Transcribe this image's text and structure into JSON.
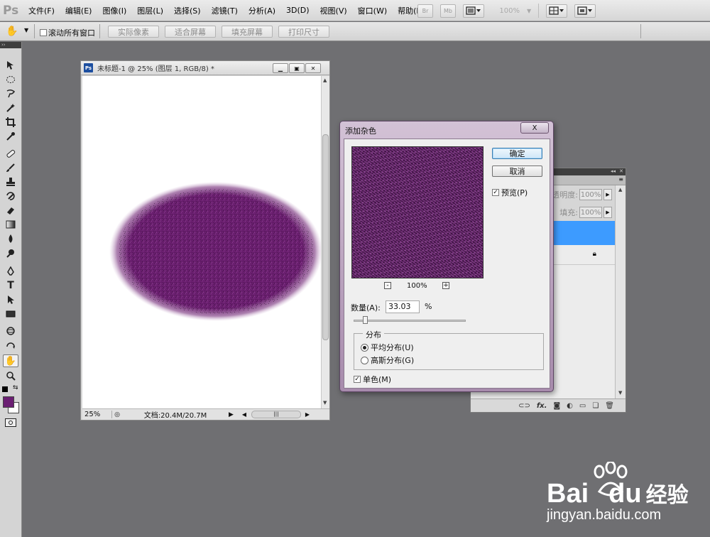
{
  "app": {
    "logo": "Ps"
  },
  "menubar": {
    "items": [
      "文件(F)",
      "编辑(E)",
      "图像(I)",
      "图层(L)",
      "选择(S)",
      "滤镜(T)",
      "分析(A)",
      "3D(D)",
      "视图(V)",
      "窗口(W)",
      "帮助(H)"
    ],
    "right": {
      "br_label": "Br",
      "mb_label": "Mb",
      "zoom": "100%"
    }
  },
  "options": {
    "scroll_all_label": "滚动所有窗口",
    "buttons": [
      "实际像素",
      "适合屏幕",
      "填充屏幕",
      "打印尺寸"
    ]
  },
  "toolbox": {
    "icons": [
      "move-tool-icon",
      "marquee-tool-icon",
      "lasso-tool-icon",
      "magic-wand-tool-icon",
      "crop-tool-icon",
      "eyedropper-tool-icon",
      "healing-brush-tool-icon",
      "brush-tool-icon",
      "clone-stamp-tool-icon",
      "history-brush-tool-icon",
      "eraser-tool-icon",
      "gradient-tool-icon",
      "blur-tool-icon",
      "dodge-tool-icon",
      "pen-tool-icon",
      "type-tool-icon",
      "path-selection-tool-icon",
      "rectangle-tool-icon",
      "3d-rotate-tool-icon",
      "3d-orbit-tool-icon",
      "hand-tool-icon",
      "zoom-tool-icon"
    ],
    "foreground_color": "#6b1f73",
    "background_color": "#ffffff"
  },
  "document": {
    "title": "未标题-1 @ 25% (图层 1, RGB/8) *",
    "zoom": "25%",
    "doc_info": "文档:20.4M/20.7M",
    "ellipse_color": "#6a1f6f"
  },
  "layers_panel": {
    "opacity_label": "不透明度:",
    "opacity_value": "100%",
    "fill_label": "填充:",
    "fill_value": "100%",
    "selected_color": "#3d9bff",
    "footer_icons": [
      "link-icon",
      "fx-icon",
      "mask-icon",
      "adjustment-icon",
      "group-icon",
      "new-layer-icon",
      "trash-icon"
    ]
  },
  "dialog": {
    "title": "添加杂色",
    "close": "X",
    "ok": "确定",
    "cancel": "取消",
    "preview_label": "预览(P)",
    "preview_checked": true,
    "zoom": "100%",
    "zoom_minus": "-",
    "zoom_plus": "+",
    "amount_label": "数量(A):",
    "amount_value": "33.03",
    "amount_unit": "%",
    "amount_slider_fraction": 0.08,
    "distribution_label": "分布",
    "uniform_label": "平均分布(U)",
    "gaussian_label": "高斯分布(G)",
    "uniform_selected": true,
    "mono_label": "单色(M)",
    "mono_checked": true,
    "noise_color": "#4e1a52"
  },
  "watermark": {
    "brand": "Bai",
    "brand_suffix": "du",
    "cn": "经验",
    "url": "jingyan.baidu.com"
  }
}
